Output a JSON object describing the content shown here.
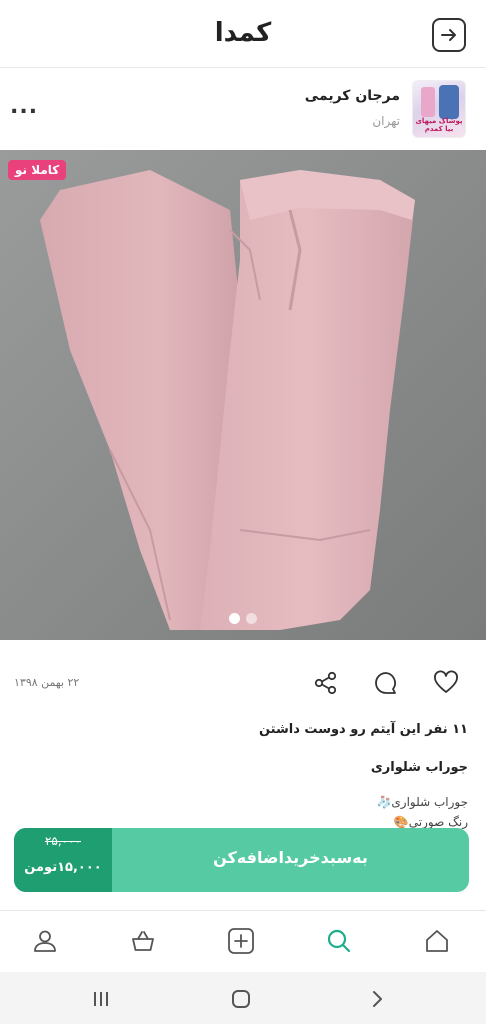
{
  "header": {
    "logo": "کمدا",
    "back_icon": "arrow-right-icon"
  },
  "seller": {
    "name": "مرجان کریمی",
    "city": "تهران",
    "avatar_caption": "پوشاک میهای بیا کمدم",
    "more_label": "..."
  },
  "photo": {
    "badge": "کاملا نو",
    "dots_total": 2,
    "active_dot": 1,
    "badge_color": "#e8417b"
  },
  "meta": {
    "date": "۲۲ بهمن ۱۳۹۸"
  },
  "likes": {
    "text": "۱۱ نفر این آیتم رو دوست داشتن"
  },
  "product": {
    "title": "جوراب شلواری",
    "desc_line1": "جوراب شلواری🧦",
    "desc_line2": "رنگ صورتی🎨"
  },
  "cart": {
    "old_price": "۲۵,۰۰۰",
    "new_price": "۱۵,۰۰۰تومن",
    "cta": "به‌سبد‌خرید‌اضافه‌کن",
    "accent": "#55caa3",
    "dark_accent": "#1f9e71"
  },
  "bottom_nav": [
    {
      "icon": "profile-icon"
    },
    {
      "icon": "basket-icon"
    },
    {
      "icon": "add-icon"
    },
    {
      "icon": "search-icon",
      "active": true
    },
    {
      "icon": "home-icon"
    }
  ],
  "colors": {
    "active_nav": "#1fae8a"
  }
}
